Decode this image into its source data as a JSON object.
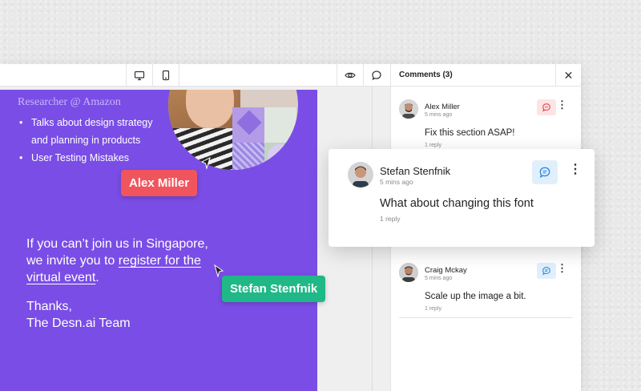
{
  "toolbar": {
    "icons": [
      "desktop-icon",
      "mobile-icon",
      "eye-icon",
      "comment-icon"
    ]
  },
  "slide": {
    "role": "Researcher @ Amazon",
    "bullets": [
      "Talks about design strategy and planning in products",
      "User Testing Mistakes"
    ],
    "body_line1": "If you can’t join us in Singapore,",
    "body_line2_pre": "we invite you to ",
    "body_link_a": "register for the",
    "body_link_b": "virtual event",
    "body_line3_post": ".",
    "thanks_line1": "Thanks,",
    "thanks_line2": "The Desn.ai Team"
  },
  "cursors": {
    "alex": "Alex Miller",
    "stefan": "Stefan Stenfnik"
  },
  "comments_panel": {
    "title": "Comments (3)",
    "close_icon": "close-icon",
    "comments": [
      {
        "name": "Alex Miller",
        "time": "5 mins ago",
        "text": "Fix this section ASAP!",
        "replies": "1 reply",
        "badge_color": "#fde4e4",
        "icon_color": "#e2474f"
      },
      {
        "name": "Craig Mckay",
        "time": "5 mins ago",
        "text": "Scale up the image a bit.",
        "replies": "1 reply",
        "badge_color": "#e1effd",
        "icon_color": "#2f8be0"
      }
    ]
  },
  "focused_comment": {
    "name": "Stefan Stenfnik",
    "time": "5 mins ago",
    "text": "What about changing this font",
    "replies": "1 reply"
  },
  "colors": {
    "slide_bg": "#7a4de6",
    "tag_red": "#f0555d",
    "tag_green": "#1fb886"
  }
}
